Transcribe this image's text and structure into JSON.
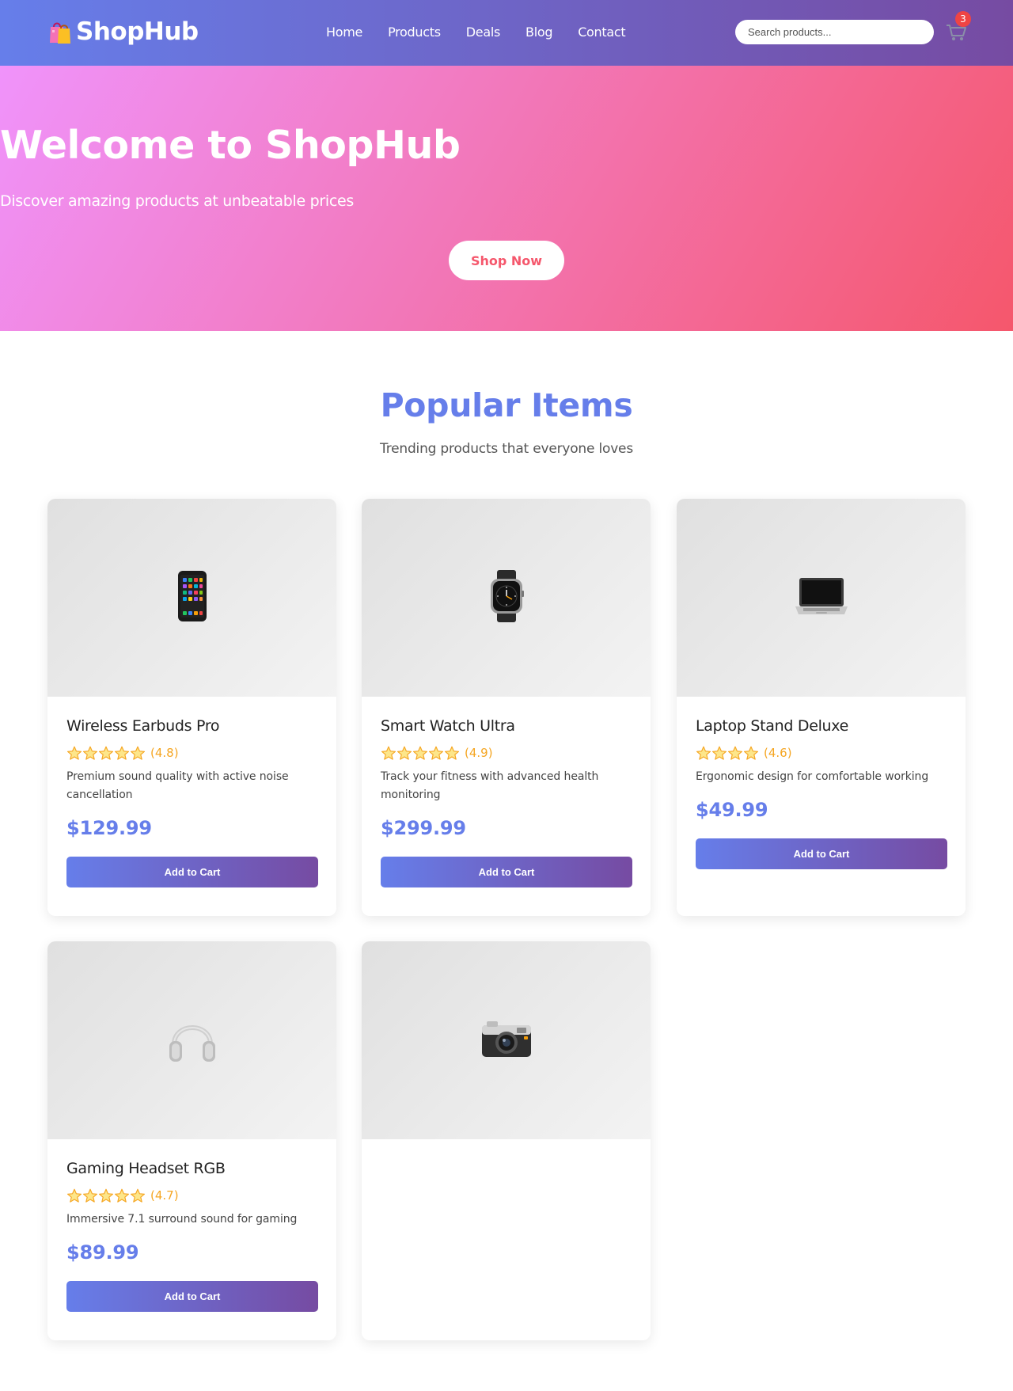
{
  "brand": {
    "name": "ShopHub"
  },
  "nav": {
    "items": [
      "Home",
      "Products",
      "Deals",
      "Blog",
      "Contact"
    ]
  },
  "search": {
    "placeholder": "Search products..."
  },
  "cart": {
    "count": "3"
  },
  "hero": {
    "title": "Welcome to ShopHub",
    "subtitle": "Discover amazing products at unbeatable prices",
    "cta": "Shop Now"
  },
  "section": {
    "title": "Popular Items",
    "subtitle": "Trending products that everyone loves"
  },
  "colors": {
    "primary": "#667eea",
    "secondary": "#764ba2",
    "hero_start": "#f093fb",
    "hero_end": "#f5576c",
    "star": "#f5a623"
  },
  "products": [
    {
      "icon": "phone-icon",
      "name": "Wireless Earbuds Pro",
      "stars": 5,
      "rating": "(4.8)",
      "description": "Premium sound quality with active noise cancellation",
      "price": "$129.99",
      "button": "Add to Cart"
    },
    {
      "icon": "watch-icon",
      "name": "Smart Watch Ultra",
      "stars": 5,
      "rating": "(4.9)",
      "description": "Track your fitness with advanced health monitoring",
      "price": "$299.99",
      "button": "Add to Cart"
    },
    {
      "icon": "laptop-icon",
      "name": "Laptop Stand Deluxe",
      "stars": 4,
      "rating": "(4.6)",
      "description": "Ergonomic design for comfortable working",
      "price": "$49.99",
      "button": "Add to Cart"
    },
    {
      "icon": "headphones-icon",
      "name": "Gaming Headset RGB",
      "stars": 5,
      "rating": "(4.7)",
      "description": "Immersive 7.1 surround sound for gaming",
      "price": "$89.99",
      "button": "Add to Cart"
    },
    {
      "icon": "camera-icon"
    }
  ]
}
